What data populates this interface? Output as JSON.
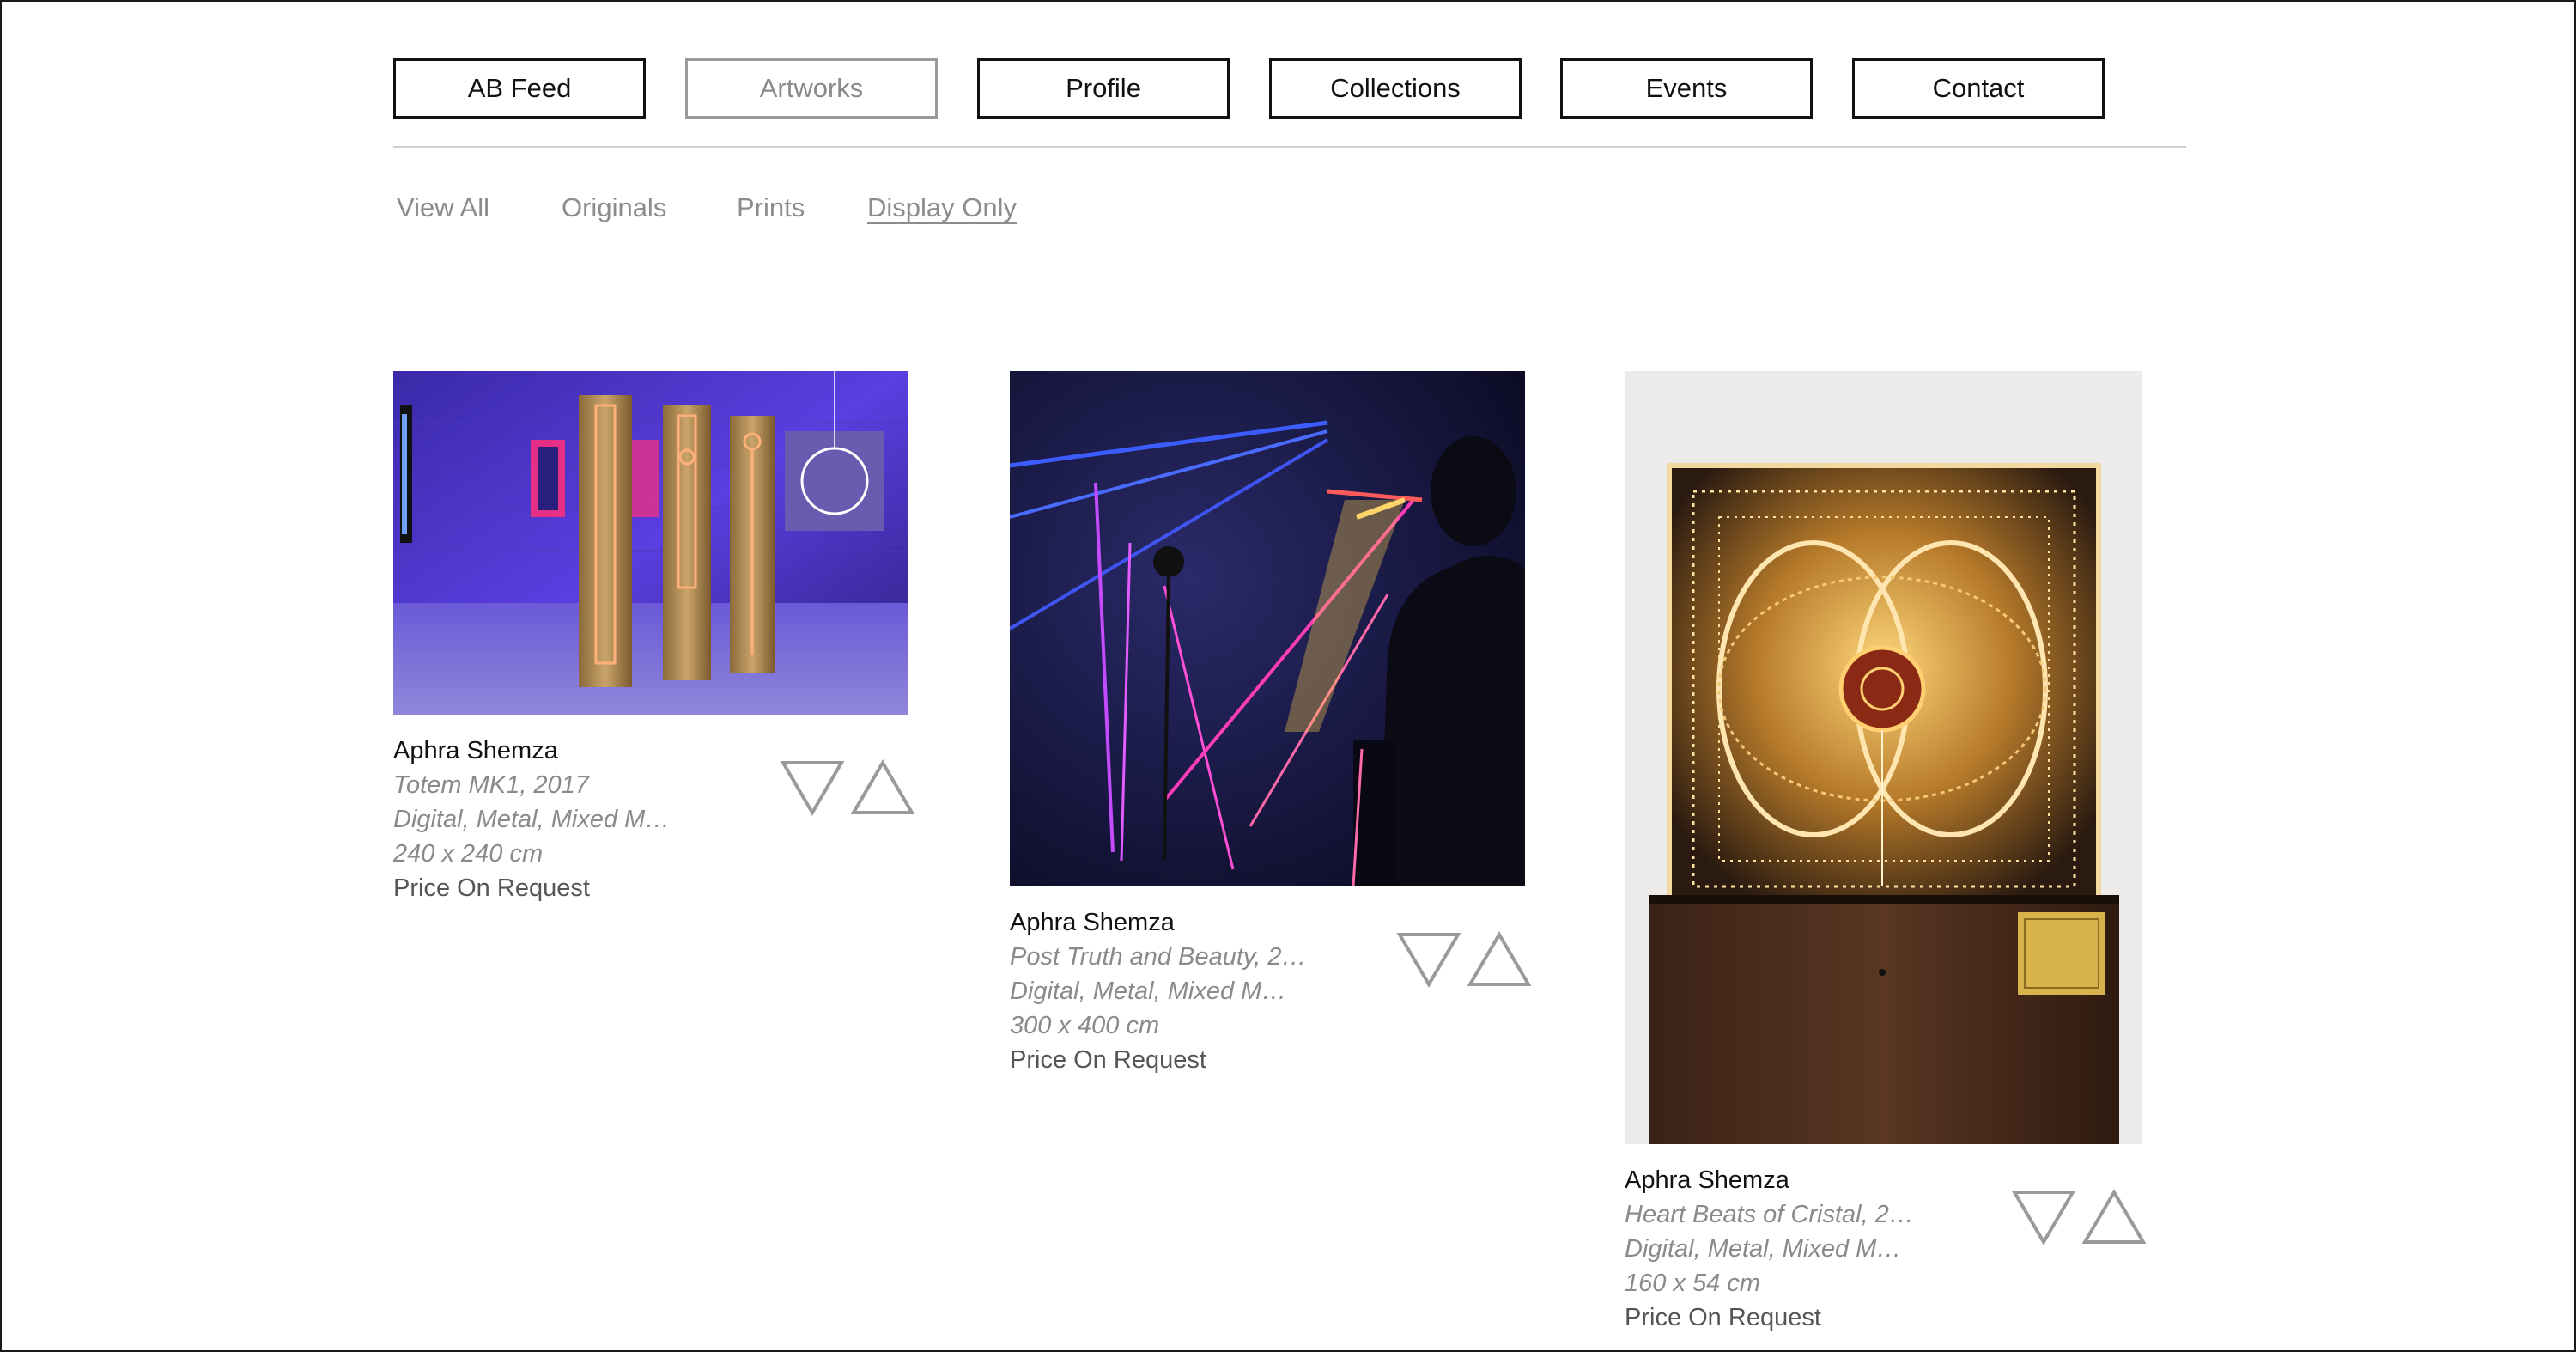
{
  "nav": {
    "items": [
      {
        "label": "AB Feed",
        "active": true
      },
      {
        "label": "Artworks",
        "active": false
      },
      {
        "label": "Profile",
        "active": true
      },
      {
        "label": "Collections",
        "active": true
      },
      {
        "label": "Events",
        "active": true
      },
      {
        "label": "Contact",
        "active": true
      }
    ]
  },
  "filters": {
    "items": [
      {
        "label": "View All"
      },
      {
        "label": "Originals"
      },
      {
        "label": "Prints"
      },
      {
        "label": "Display Only",
        "selected": true
      }
    ]
  },
  "artworks": [
    {
      "artist": "Aphra Shemza",
      "title": "Totem MK1, 2017",
      "medium": "Digital, Metal, Mixed M…",
      "size": "240 x 240 cm",
      "price": "Price On Request"
    },
    {
      "artist": "Aphra Shemza",
      "title": "Post Truth and Beauty, 2…",
      "medium": "Digital, Metal, Mixed M…",
      "size": "300 x 400 cm",
      "price": "Price On Request"
    },
    {
      "artist": "Aphra Shemza",
      "title": "Heart Beats of Cristal, 2…",
      "medium": "Digital, Metal, Mixed M…",
      "size": "160 x 54 cm",
      "price": "Price On Request"
    }
  ],
  "colors": {
    "border": "#111111",
    "muted": "#8a8a8a",
    "rule": "#cfcfcf",
    "vote_icon": "#9a9a9a"
  },
  "icons": {
    "downvote": "triangle-down-icon",
    "upvote": "triangle-up-icon"
  }
}
